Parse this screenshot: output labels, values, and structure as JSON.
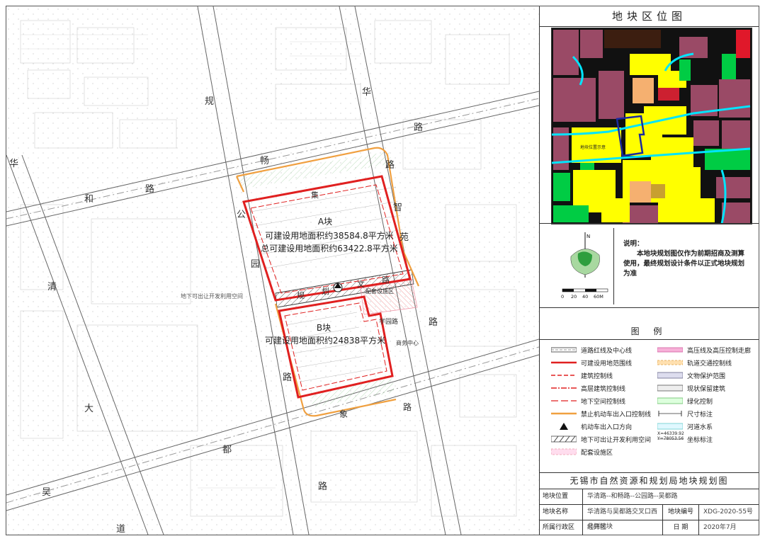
{
  "panel": {
    "title": "地块区位图",
    "loc_map_label": "地块位置示意",
    "compass_n": "N",
    "scale_ticks": [
      "0",
      "20",
      "40",
      "60M"
    ],
    "note_head": "说明：",
    "note_body": "本地块规划图仅作为前期招商及测算使用，最终规划设计条件以正式地块规划为准",
    "legend_title": "图 例",
    "legend": [
      {
        "label": "道路红线及中心线",
        "sym": "road"
      },
      {
        "label": "高压线及高压控制走廊",
        "sym": "hv"
      },
      {
        "label": "可建设用地范围线",
        "sym": "red-thick"
      },
      {
        "label": "轨道交通控制线",
        "sym": "rail"
      },
      {
        "label": "建筑控制线",
        "sym": "red-dash"
      },
      {
        "label": "文物保护范围",
        "sym": "relic"
      },
      {
        "label": "高层建筑控制线",
        "sym": "red-dashdot"
      },
      {
        "label": "现状保留建筑",
        "sym": "keep"
      },
      {
        "label": "地下空间控制线",
        "sym": "red-long"
      },
      {
        "label": "绿化控制",
        "sym": "green"
      },
      {
        "label": "禁止机动车出入口控制线",
        "sym": "orange"
      },
      {
        "label": "尺寸标注",
        "sym": "dim"
      },
      {
        "label": "机动车出入口方向",
        "sym": "arrow"
      },
      {
        "label": "河道水系",
        "sym": "water"
      },
      {
        "label": "地下可出让开发利用空间",
        "sym": "hatch"
      },
      {
        "label": "坐标标注",
        "sym": "coord"
      },
      {
        "label": "配套设施区",
        "sym": "facility"
      }
    ],
    "coord_sample": [
      "X=46339.92",
      "Y=78053.56"
    ],
    "titleblock": {
      "header": "无锡市自然资源和规划局地块规划图",
      "row1_label": "地块位置",
      "row1_value": "华清路--和畅路--公园路--吴都路",
      "row2_label": "地块名称",
      "row2_value": "华清路与吴都路交叉口西北侧地块",
      "row2_label2": "地块编号",
      "row2_value2": "XDG-2020-55号",
      "row3_label": "所属行政区",
      "row3_value": "经开区",
      "row3_label2": "日 期",
      "row3_value2": "2020年7月"
    }
  },
  "map": {
    "block_a_title": "A块",
    "block_a_line1": "可建设用地面积约38584.8平方米",
    "block_a_line2": "总可建设用地面积约63422.8平方米",
    "block_b_title": "B块",
    "block_b_line1": "可建设用地面积约24838平方米",
    "facility": "配套设施区",
    "underground": "地下可出让开发利用空间",
    "hua_1": "华",
    "lu_1": "路",
    "gui": "规",
    "hua_2": "华",
    "he": "和",
    "lu_2": "路",
    "chang": "畅",
    "lu_3": "路",
    "gong": "公",
    "yuan": "园",
    "lu_4": "路",
    "zhi": "智",
    "yuan2": "苑",
    "lu_5": "路",
    "qing": "清",
    "da": "大",
    "du": "都",
    "wu": "吴",
    "dao": "道",
    "lu_6": "路",
    "gui2": "规",
    "hua3": "划",
    "wen": "文",
    "lu_7": "路",
    "lu_8": "路",
    "road_b": "路",
    "ji": "集",
    "xiang": "象",
    "jing": "沁",
    "lu_9": "路",
    "xuelu": "学园路",
    "small_center": "商务中心"
  },
  "colors": {
    "red_line": "#e02020",
    "orange_line": "#f0a040",
    "residential": "#9a4a66",
    "commercial": "#ffff00",
    "green": "#00cc44",
    "water": "#00e5ff",
    "road": "#111111"
  }
}
